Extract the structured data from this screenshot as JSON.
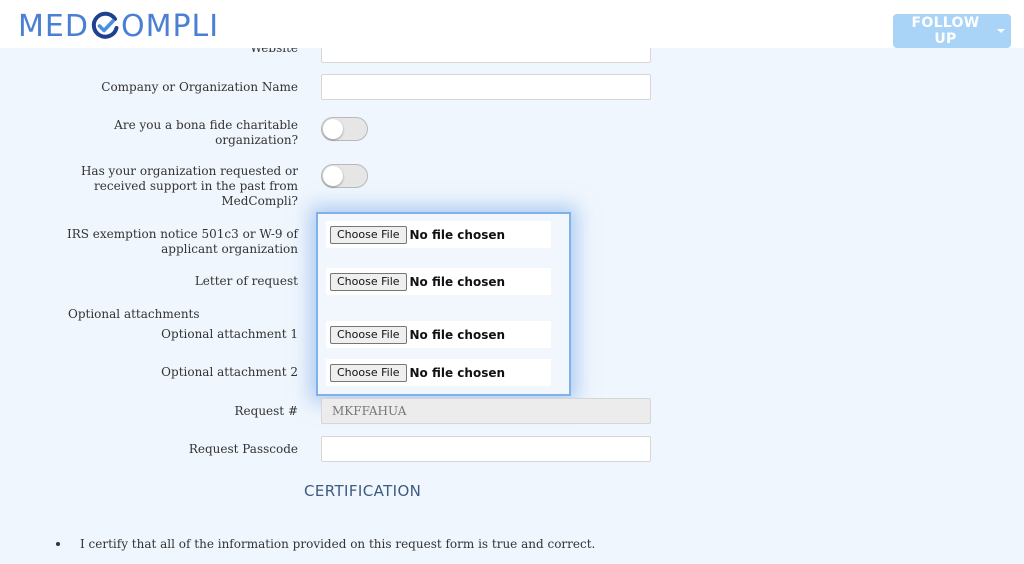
{
  "header": {
    "logo_text_left": "MED",
    "logo_text_right": "OMPLI",
    "follow_up_label": "FOLLOW UP"
  },
  "form": {
    "website_label": "Website",
    "company_label": "Company or Organization Name",
    "company_value": "",
    "charitable_label_line1": "Are you a bona fide charitable",
    "charitable_label_line2": "organization?",
    "charitable_on": false,
    "support_label_line1": "Has your organization requested or",
    "support_label_line2": "received support in the past from",
    "support_label_line3": "MedCompli?",
    "support_on": false,
    "irs_label_line1": "IRS exemption notice 501c3 or W-9 of",
    "irs_label_line2": "applicant organization",
    "letter_label": "Letter of request",
    "optional_heading": "Optional attachments",
    "attachment1_label": "Optional attachment 1",
    "attachment2_label": "Optional attachment 2",
    "choose_file_label": "Choose File",
    "no_file_label": "No file chosen",
    "request_label": "Request #",
    "request_value": "MKFFAHUA",
    "passcode_label": "Request Passcode",
    "passcode_value": ""
  },
  "certification": {
    "title": "CERTIFICATION",
    "item1": "I certify that all of the information provided on this request form is true and correct."
  },
  "colors": {
    "page_bg": "#f0f6fd",
    "brand_blue": "#4a7fd3",
    "button_blue": "#a9d3f7",
    "highlight_border": "#7fb2ea",
    "cert_title": "#3d5a80"
  }
}
